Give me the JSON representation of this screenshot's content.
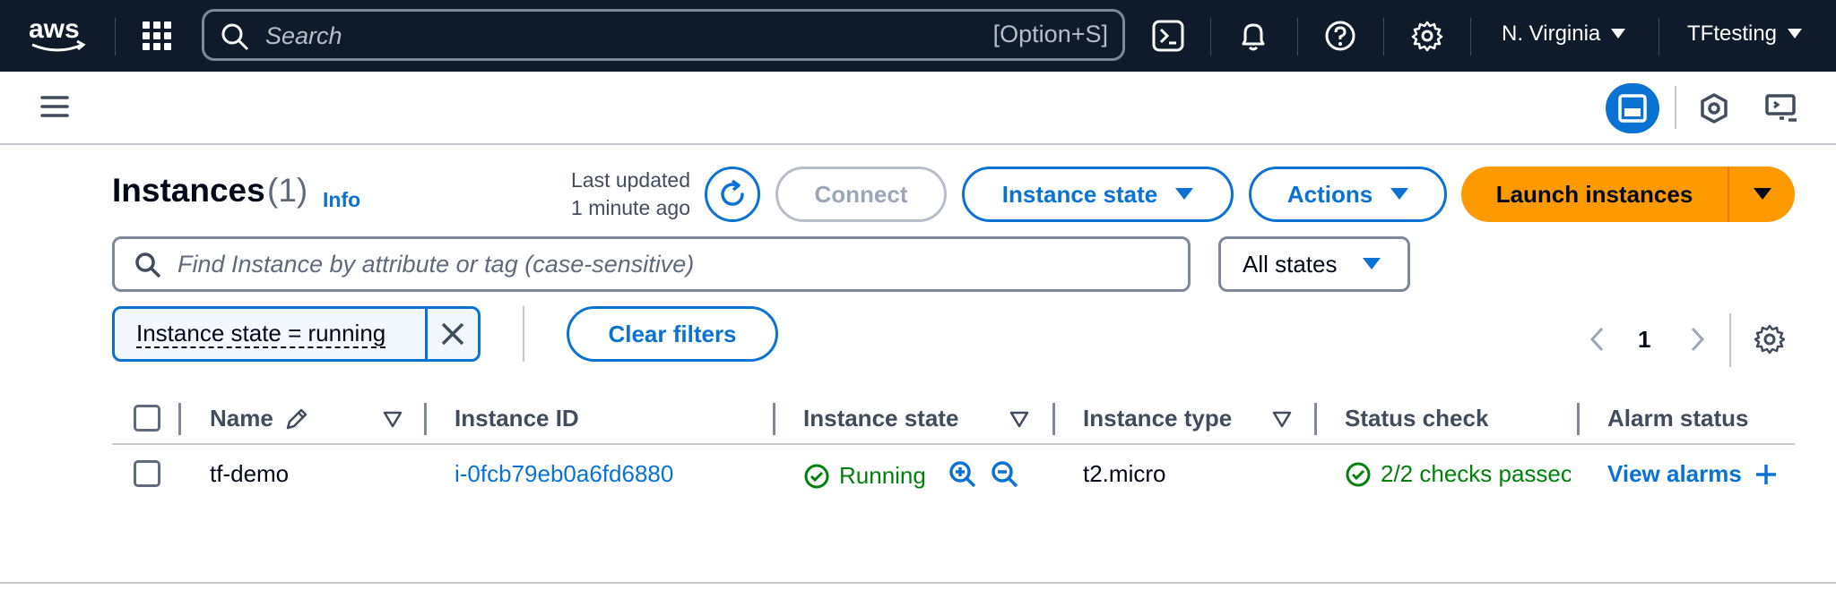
{
  "topnav": {
    "logo_text": "aws",
    "search_placeholder": "Search",
    "search_shortcut": "[Option+S]",
    "region": "N. Virginia",
    "account": "TFtesting",
    "icons": [
      "grid-icon",
      "cloudshell-icon",
      "bell-icon",
      "help-icon",
      "gear-icon"
    ]
  },
  "subbar": {
    "icons": [
      "hamburger-icon",
      "split-panel-icon",
      "hexagon-icon",
      "monitor-icon"
    ]
  },
  "header": {
    "title": "Instances",
    "count": "(1)",
    "info": "Info",
    "last_updated_line1": "Last updated",
    "last_updated_line2": "1 minute ago",
    "connect": "Connect",
    "instance_state": "Instance state",
    "actions": "Actions",
    "launch": "Launch instances"
  },
  "filter": {
    "placeholder": "Find Instance by attribute or tag (case-sensitive)",
    "states_select": "All states",
    "token": "Instance state = running",
    "clear": "Clear filters"
  },
  "pagination": {
    "current_page": "1"
  },
  "table": {
    "columns": [
      "Name",
      "Instance ID",
      "Instance state",
      "Instance type",
      "Status check",
      "Alarm status"
    ],
    "rows": [
      {
        "name": "tf-demo",
        "instance_id": "i-0fcb79eb0a6fd6880",
        "state": "Running",
        "type": "t2.micro",
        "status_check": "2/2 checks passec",
        "alarm": "View alarms"
      }
    ]
  },
  "colors": {
    "nav_bg": "#0f1b2a",
    "accent_blue": "#0972d3",
    "launch_orange": "#ff9900",
    "success_green": "#037f0c"
  }
}
